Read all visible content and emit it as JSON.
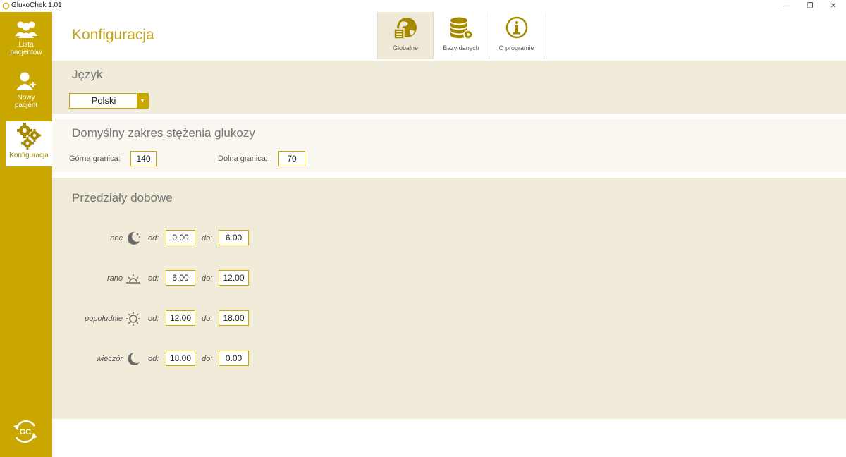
{
  "window": {
    "title": "GlukoChek 1.01",
    "min_glyph": "—",
    "max_glyph": "❐",
    "close_glyph": "✕"
  },
  "sidebar": {
    "items": [
      {
        "label": "Lista pacjentów",
        "icon": "users-icon"
      },
      {
        "label": "Nowy pacjent",
        "icon": "add-user-icon"
      },
      {
        "label": "Konfiguracja",
        "icon": "gears-icon"
      }
    ],
    "logo_icon": "gc-logo-icon"
  },
  "page": {
    "title": "Konfiguracja"
  },
  "tabs": [
    {
      "label": "Globalne",
      "icon": "globe-icon",
      "active": true
    },
    {
      "label": "Bazy danych",
      "icon": "database-icon",
      "active": false
    },
    {
      "label": "O programie",
      "icon": "info-icon",
      "active": false
    }
  ],
  "language": {
    "title": "Język",
    "selected": "Polski"
  },
  "glucose": {
    "title": "Domyślny zakres stężenia glukozy",
    "upper_label": "Górna granica:",
    "upper_value": "140",
    "lower_label": "Dolna granica:",
    "lower_value": "70"
  },
  "periods": {
    "title": "Przedziały dobowe",
    "from_label": "od:",
    "to_label": "do:",
    "items": [
      {
        "name": "noc",
        "icon": "moon-stars-icon",
        "from": "0.00",
        "to": "6.00"
      },
      {
        "name": "rano",
        "icon": "sunrise-icon",
        "from": "6.00",
        "to": "12.00"
      },
      {
        "name": "popołudnie",
        "icon": "sun-icon",
        "from": "12.00",
        "to": "18.00"
      },
      {
        "name": "wieczór",
        "icon": "moon-icon",
        "from": "18.00",
        "to": "0.00"
      }
    ]
  },
  "colors": {
    "accent": "#c9a700",
    "section_bg": "#f1ebd9",
    "title_color": "#c2a21a"
  }
}
